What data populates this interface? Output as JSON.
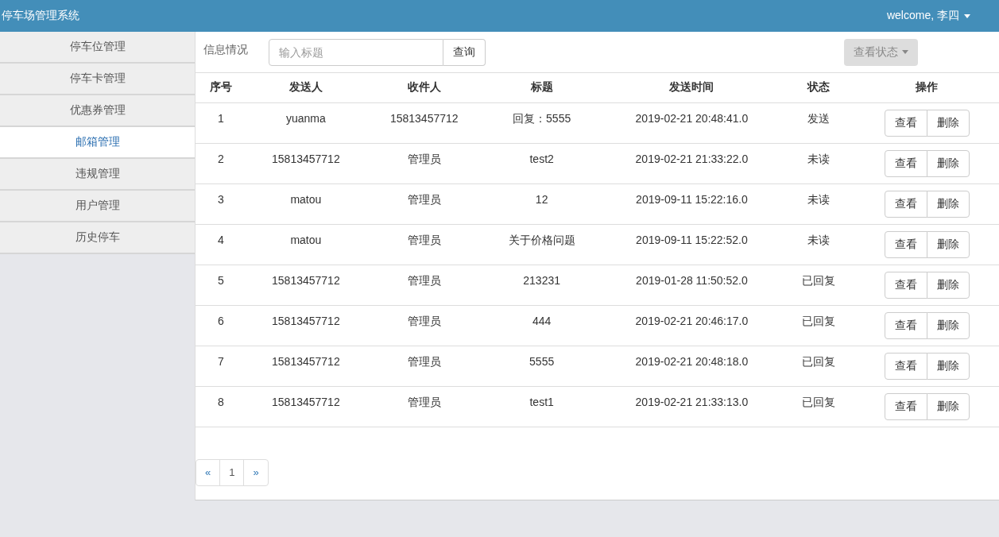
{
  "header": {
    "title": "停车场管理系统",
    "user_menu": "welcome, 李四"
  },
  "sidebar": {
    "items": [
      {
        "label": "停车位管理",
        "selected": false
      },
      {
        "label": "停车卡管理",
        "selected": false
      },
      {
        "label": "优惠券管理",
        "selected": false
      },
      {
        "label": "邮箱管理",
        "selected": true
      },
      {
        "label": "违规管理",
        "selected": false
      },
      {
        "label": "用户管理",
        "selected": false
      },
      {
        "label": "历史停车",
        "selected": false
      }
    ]
  },
  "toolbar": {
    "label": "信息情况",
    "search": {
      "placeholder": "输入标题"
    },
    "search_button": "查询",
    "status_dropdown": "查看状态"
  },
  "table": {
    "columns": [
      "序号",
      "发送人",
      "收件人",
      "标题",
      "发送时间",
      "状态",
      "操作"
    ],
    "rows": [
      {
        "cells": [
          "1",
          "yuanma",
          "15813457712",
          "回复：5555",
          "2019-02-21 20:48:41.0",
          "发送"
        ],
        "actions": [
          "查看",
          "删除"
        ]
      },
      {
        "cells": [
          "2",
          "15813457712",
          "管理员",
          "test2",
          "2019-02-21 21:33:22.0",
          "未读"
        ],
        "actions": [
          "查看",
          "删除"
        ]
      },
      {
        "cells": [
          "3",
          "matou",
          "管理员",
          "12",
          "2019-09-11 15:22:16.0",
          "未读"
        ],
        "actions": [
          "查看",
          "删除"
        ]
      },
      {
        "cells": [
          "4",
          "matou",
          "管理员",
          "关于价格问题",
          "2019-09-11 15:22:52.0",
          "未读"
        ],
        "actions": [
          "查看",
          "删除"
        ]
      },
      {
        "cells": [
          "5",
          "15813457712",
          "管理员",
          "213231",
          "2019-01-28 11:50:52.0",
          "已回复"
        ],
        "actions": [
          "查看",
          "删除"
        ]
      },
      {
        "cells": [
          "6",
          "15813457712",
          "管理员",
          "444",
          "2019-02-21 20:46:17.0",
          "已回复"
        ],
        "actions": [
          "查看",
          "删除"
        ]
      },
      {
        "cells": [
          "7",
          "15813457712",
          "管理员",
          "5555",
          "2019-02-21 20:48:18.0",
          "已回复"
        ],
        "actions": [
          "查看",
          "删除"
        ]
      },
      {
        "cells": [
          "8",
          "15813457712",
          "管理员",
          "test1",
          "2019-02-21 21:33:13.0",
          "已回复"
        ],
        "actions": [
          "查看",
          "删除"
        ]
      }
    ]
  },
  "pagination": [
    "«",
    "1",
    "»"
  ]
}
